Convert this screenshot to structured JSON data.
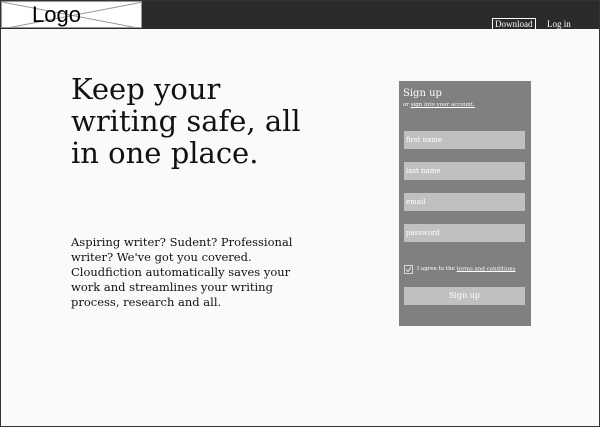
{
  "header": {
    "logo_text": "Logo",
    "nav": {
      "download_label": "Download",
      "login_label": "Log in"
    }
  },
  "hero": {
    "headline": "Keep your writing safe, all in one place.",
    "tagline": "Aspiring writer? Sudent? Professional writer? We've got you covered. Cloudfiction automatically saves your work and streamlines your writing process, research and all."
  },
  "signup": {
    "title": "Sign up",
    "signin_prefix": "or ",
    "signin_link": "sign into your account.",
    "fields": {
      "first_name": "first name",
      "last_name": "last name",
      "email": "email",
      "password": "password"
    },
    "agree_text": "I agree to the ",
    "terms_link": "terms and conditions",
    "terms_checked": true,
    "button_label": "Sign up"
  },
  "colors": {
    "topbar": "#2b2b2b",
    "panel": "#808080",
    "field": "#c0c0c0",
    "page_bg": "#fafafa"
  }
}
